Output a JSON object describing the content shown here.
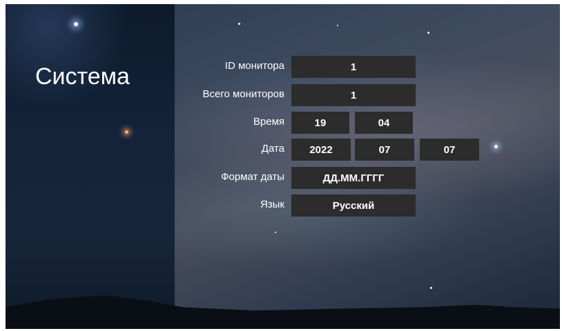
{
  "screen": {
    "title": "Система"
  },
  "rows": {
    "monitor_id": {
      "label": "ID монитора",
      "value": "1"
    },
    "total_monitors": {
      "label": "Всего мониторов",
      "value": "1"
    },
    "time": {
      "label": "Время",
      "hour": "19",
      "minute": "04"
    },
    "date": {
      "label": "Дата",
      "year": "2022",
      "month": "07",
      "day": "07"
    },
    "date_format": {
      "label": "Формат даты",
      "value": "ДД.ММ.ГГГГ"
    },
    "language": {
      "label": "Язык",
      "value": "Русский"
    }
  },
  "colors": {
    "field_bg": "#2c2c2c",
    "text": "#ffffff"
  }
}
